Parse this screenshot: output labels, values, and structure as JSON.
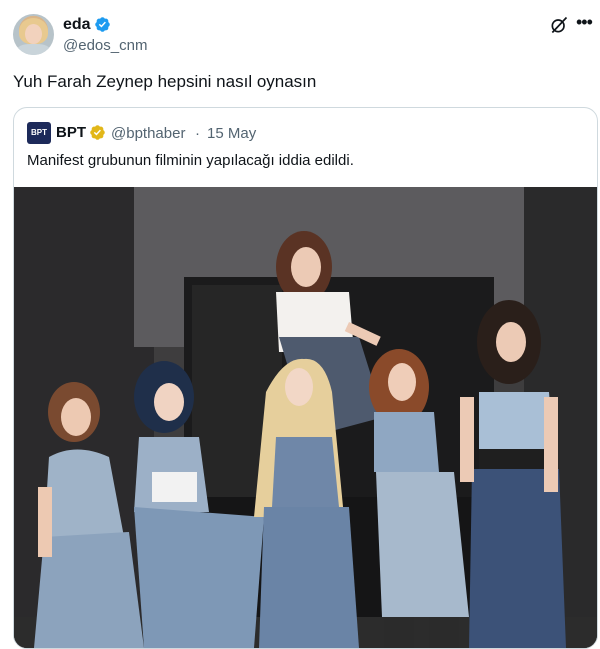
{
  "author": {
    "name": "eda",
    "handle": "@edos_cnm",
    "verified_color": "#1d9bf0"
  },
  "tweet": {
    "text": "Yuh Farah Zeynep hepsini nasıl oynasın"
  },
  "quote": {
    "logo_text": "BPT",
    "name": "BPT",
    "badge_color": "#e2b719",
    "handle": "@bpthaber",
    "separator": "·",
    "date": "15 May",
    "text": "Manifest grubunun filminin yapılacağı iddia edildi.",
    "photo_label": "group photo of six women in denim outfits"
  },
  "icons": {
    "grok": "grok-icon",
    "more": "more-icon"
  }
}
